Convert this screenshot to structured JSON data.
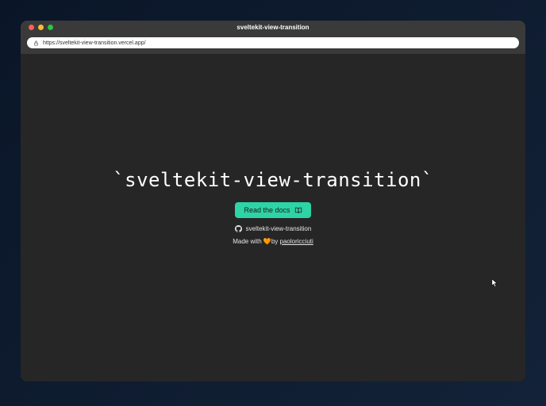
{
  "window": {
    "title": "sveltekit-view-transition"
  },
  "address": {
    "url": "https://sveltekit-view-transition.vercel.app/"
  },
  "hero": {
    "title": "`sveltekit-view-transition`",
    "docs_button_label": "Read the docs",
    "github_label": "sveltekit-view-transition",
    "made_with_prefix": "Made with 🧡by ",
    "author": "paoloricciuti"
  }
}
